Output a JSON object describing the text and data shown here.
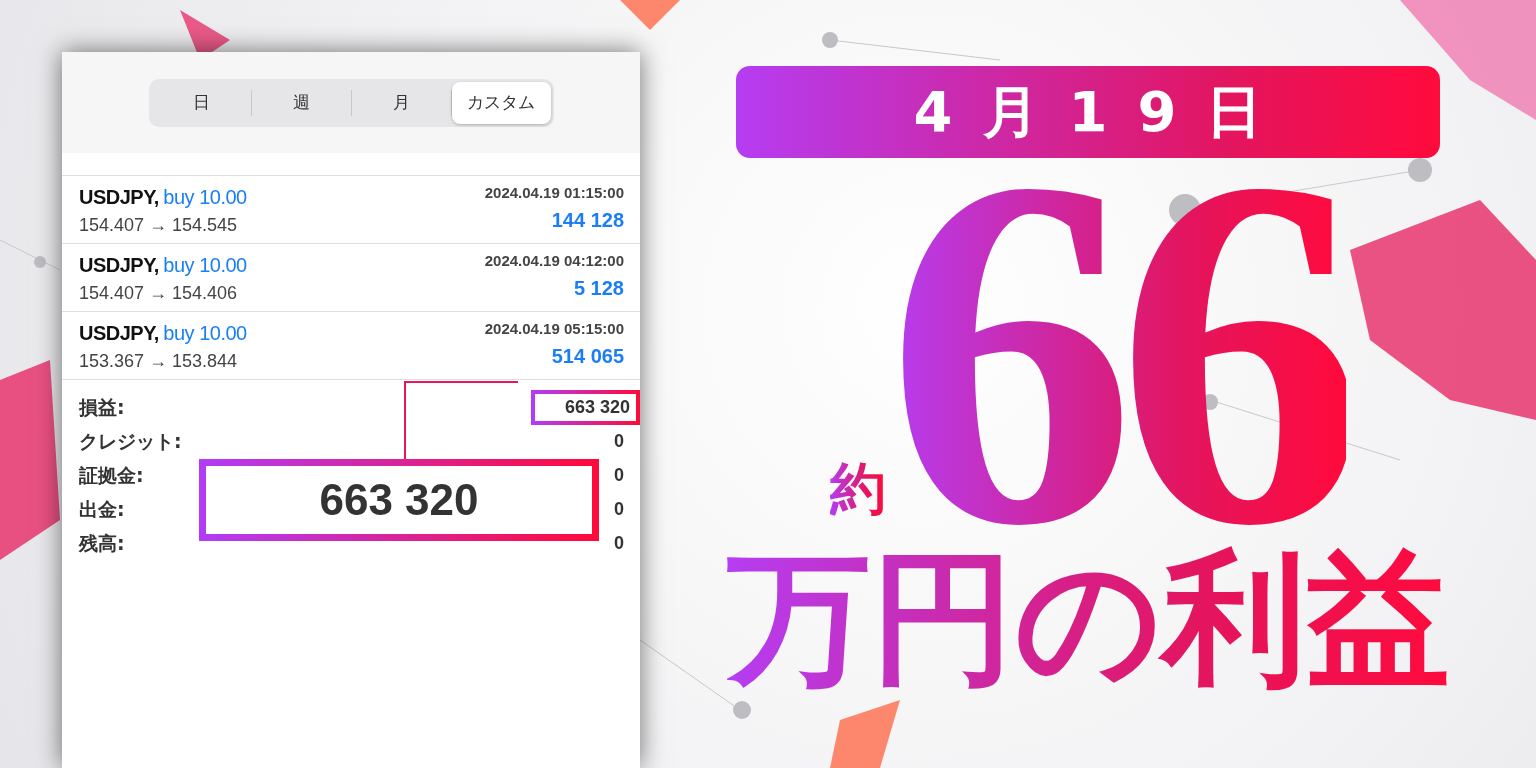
{
  "tabs": [
    {
      "label": "日",
      "selected": false
    },
    {
      "label": "週",
      "selected": false
    },
    {
      "label": "月",
      "selected": false
    },
    {
      "label": "カスタム",
      "selected": true
    }
  ],
  "trades": [
    {
      "symbol": "USDJPY,",
      "side": "buy 10.00",
      "prices": "154.407 → 154.545",
      "time": "2024.04.19 01:15:00",
      "profit": "144 128"
    },
    {
      "symbol": "USDJPY,",
      "side": "buy 10.00",
      "prices": "154.407 → 154.406",
      "time": "2024.04.19 04:12:00",
      "profit": "5 128"
    },
    {
      "symbol": "USDJPY,",
      "side": "buy 10.00",
      "prices": "153.367 → 153.844",
      "time": "2024.04.19 05:15:00",
      "profit": "514 065"
    }
  ],
  "summary": [
    {
      "label": "損益:",
      "value": "663 320",
      "highlighted": true
    },
    {
      "label": "クレジット:",
      "value": "0",
      "highlighted": false
    },
    {
      "label": "証拠金:",
      "value": "0",
      "highlighted": false
    },
    {
      "label": "出金:",
      "value": "0",
      "highlighted": false
    },
    {
      "label": "残高:",
      "value": "0",
      "highlighted": false
    }
  ],
  "callout": {
    "value": "663 320"
  },
  "headline": {
    "date": "4月19日",
    "prefix": "約",
    "amount": "66",
    "suffix": "万円の利益"
  }
}
